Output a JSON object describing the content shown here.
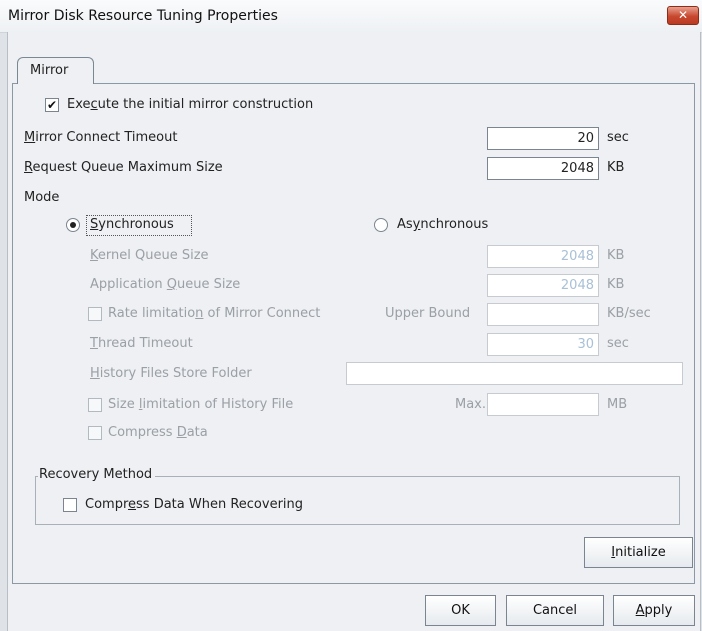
{
  "window": {
    "title": "Mirror Disk Resource Tuning Properties",
    "close_glyph": "✕"
  },
  "tab": {
    "label": "Mirror"
  },
  "initial_mirror": {
    "label_pre": "Exe",
    "label_mn": "c",
    "label_post": "ute the initial mirror construction",
    "checked": true,
    "check_glyph": "✔"
  },
  "connect_timeout": {
    "label_mn": "M",
    "label_post": "irror Connect Timeout",
    "value": "20",
    "unit": "sec"
  },
  "request_queue": {
    "label_mn": "R",
    "label_post": "equest Queue Maximum Size",
    "value": "2048",
    "unit": "KB"
  },
  "mode": {
    "label": "Mode",
    "synchronous": {
      "label_mn": "S",
      "label_post": "ynchronous",
      "selected": true
    },
    "asynchronous": {
      "label_pre": "As",
      "label_mn": "y",
      "label_post": "nchronous",
      "selected": false
    }
  },
  "kernel_queue": {
    "label_mn": "K",
    "label_post": "ernel Queue Size",
    "value": "2048",
    "unit": "KB"
  },
  "application_queue": {
    "label_pre": "Application ",
    "label_mn": "Q",
    "label_post": "ueue Size",
    "value": "2048",
    "unit": "KB"
  },
  "rate_limitation": {
    "label_pre": "Rate limitatio",
    "label_mn": "n",
    "label_post": " of Mirror Connect",
    "checked": false,
    "upper_bound_label": "Upper Bound",
    "value": "",
    "unit": "KB/sec"
  },
  "thread_timeout": {
    "label_mn": "T",
    "label_post": "hread Timeout",
    "value": "30",
    "unit": "sec"
  },
  "history_folder": {
    "label_mn": "H",
    "label_post": "istory Files Store Folder",
    "value": ""
  },
  "history_size": {
    "label_pre": "Size ",
    "label_mn": "l",
    "label_post": "imitation of History File",
    "checked": false,
    "max_label": "Max.",
    "value": "",
    "unit": "MB"
  },
  "compress_data": {
    "label_pre": "Compress ",
    "label_mn": "D",
    "label_post": "ata",
    "checked": false
  },
  "recovery": {
    "group_label": "Recovery Method",
    "compress_label_pre": "Compr",
    "compress_label_mn": "e",
    "compress_label_post": "ss Data When Recovering",
    "checked": false
  },
  "buttons": {
    "initialize_mn": "I",
    "initialize_post": "nitialize",
    "ok": "OK",
    "cancel": "Cancel",
    "apply_mn": "A",
    "apply_post": "pply"
  }
}
